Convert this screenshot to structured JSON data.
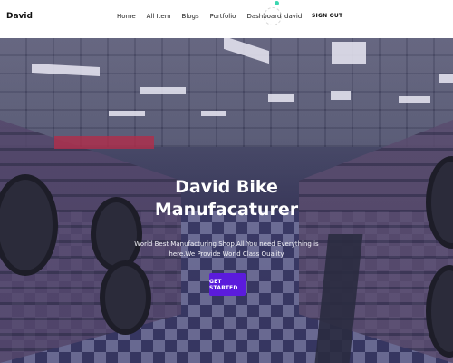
{
  "nav": {
    "brand": "David",
    "links": [
      "Home",
      "All Item",
      "Blogs",
      "Portfolio",
      "Dashboard"
    ],
    "user_name": "david",
    "signout_label": "SIGN OUT",
    "status_dot_color": "#3cd6b0"
  },
  "hero": {
    "title_line1": "David Bike",
    "title_line2": "Manufacaturer",
    "subtitle_line1": "World Best Manufacturing Shop.All You need Everything is",
    "subtitle_line2": "here.We Provide World Class Quality",
    "cta_label": "GET STARTED",
    "cta_color": "#5b1bdc"
  }
}
